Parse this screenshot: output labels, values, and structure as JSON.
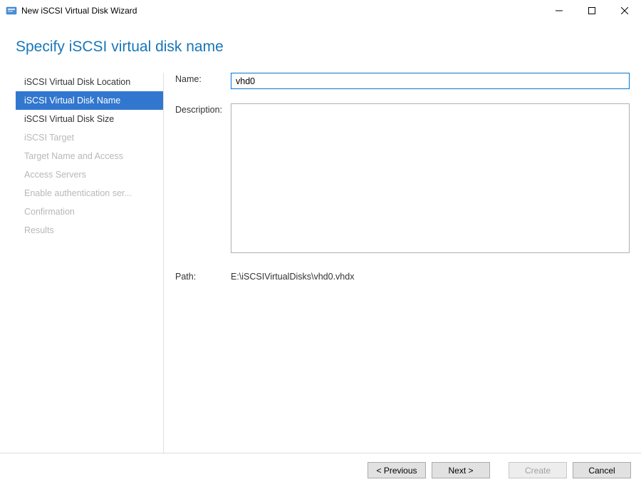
{
  "window": {
    "title": "New iSCSI Virtual Disk Wizard"
  },
  "heading": "Specify iSCSI virtual disk name",
  "sidebar": {
    "items": [
      {
        "label": "iSCSI Virtual Disk Location",
        "state": "enabled"
      },
      {
        "label": "iSCSI Virtual Disk Name",
        "state": "selected"
      },
      {
        "label": "iSCSI Virtual Disk Size",
        "state": "enabled"
      },
      {
        "label": "iSCSI Target",
        "state": "disabled"
      },
      {
        "label": "Target Name and Access",
        "state": "disabled"
      },
      {
        "label": "Access Servers",
        "state": "disabled"
      },
      {
        "label": "Enable authentication ser...",
        "state": "disabled"
      },
      {
        "label": "Confirmation",
        "state": "disabled"
      },
      {
        "label": "Results",
        "state": "disabled"
      }
    ]
  },
  "form": {
    "name_label": "Name:",
    "name_value": "vhd0",
    "description_label": "Description:",
    "description_value": "",
    "path_label": "Path:",
    "path_value": "E:\\iSCSIVirtualDisks\\vhd0.vhdx"
  },
  "buttons": {
    "previous": "< Previous",
    "next": "Next >",
    "create": "Create",
    "cancel": "Cancel"
  }
}
